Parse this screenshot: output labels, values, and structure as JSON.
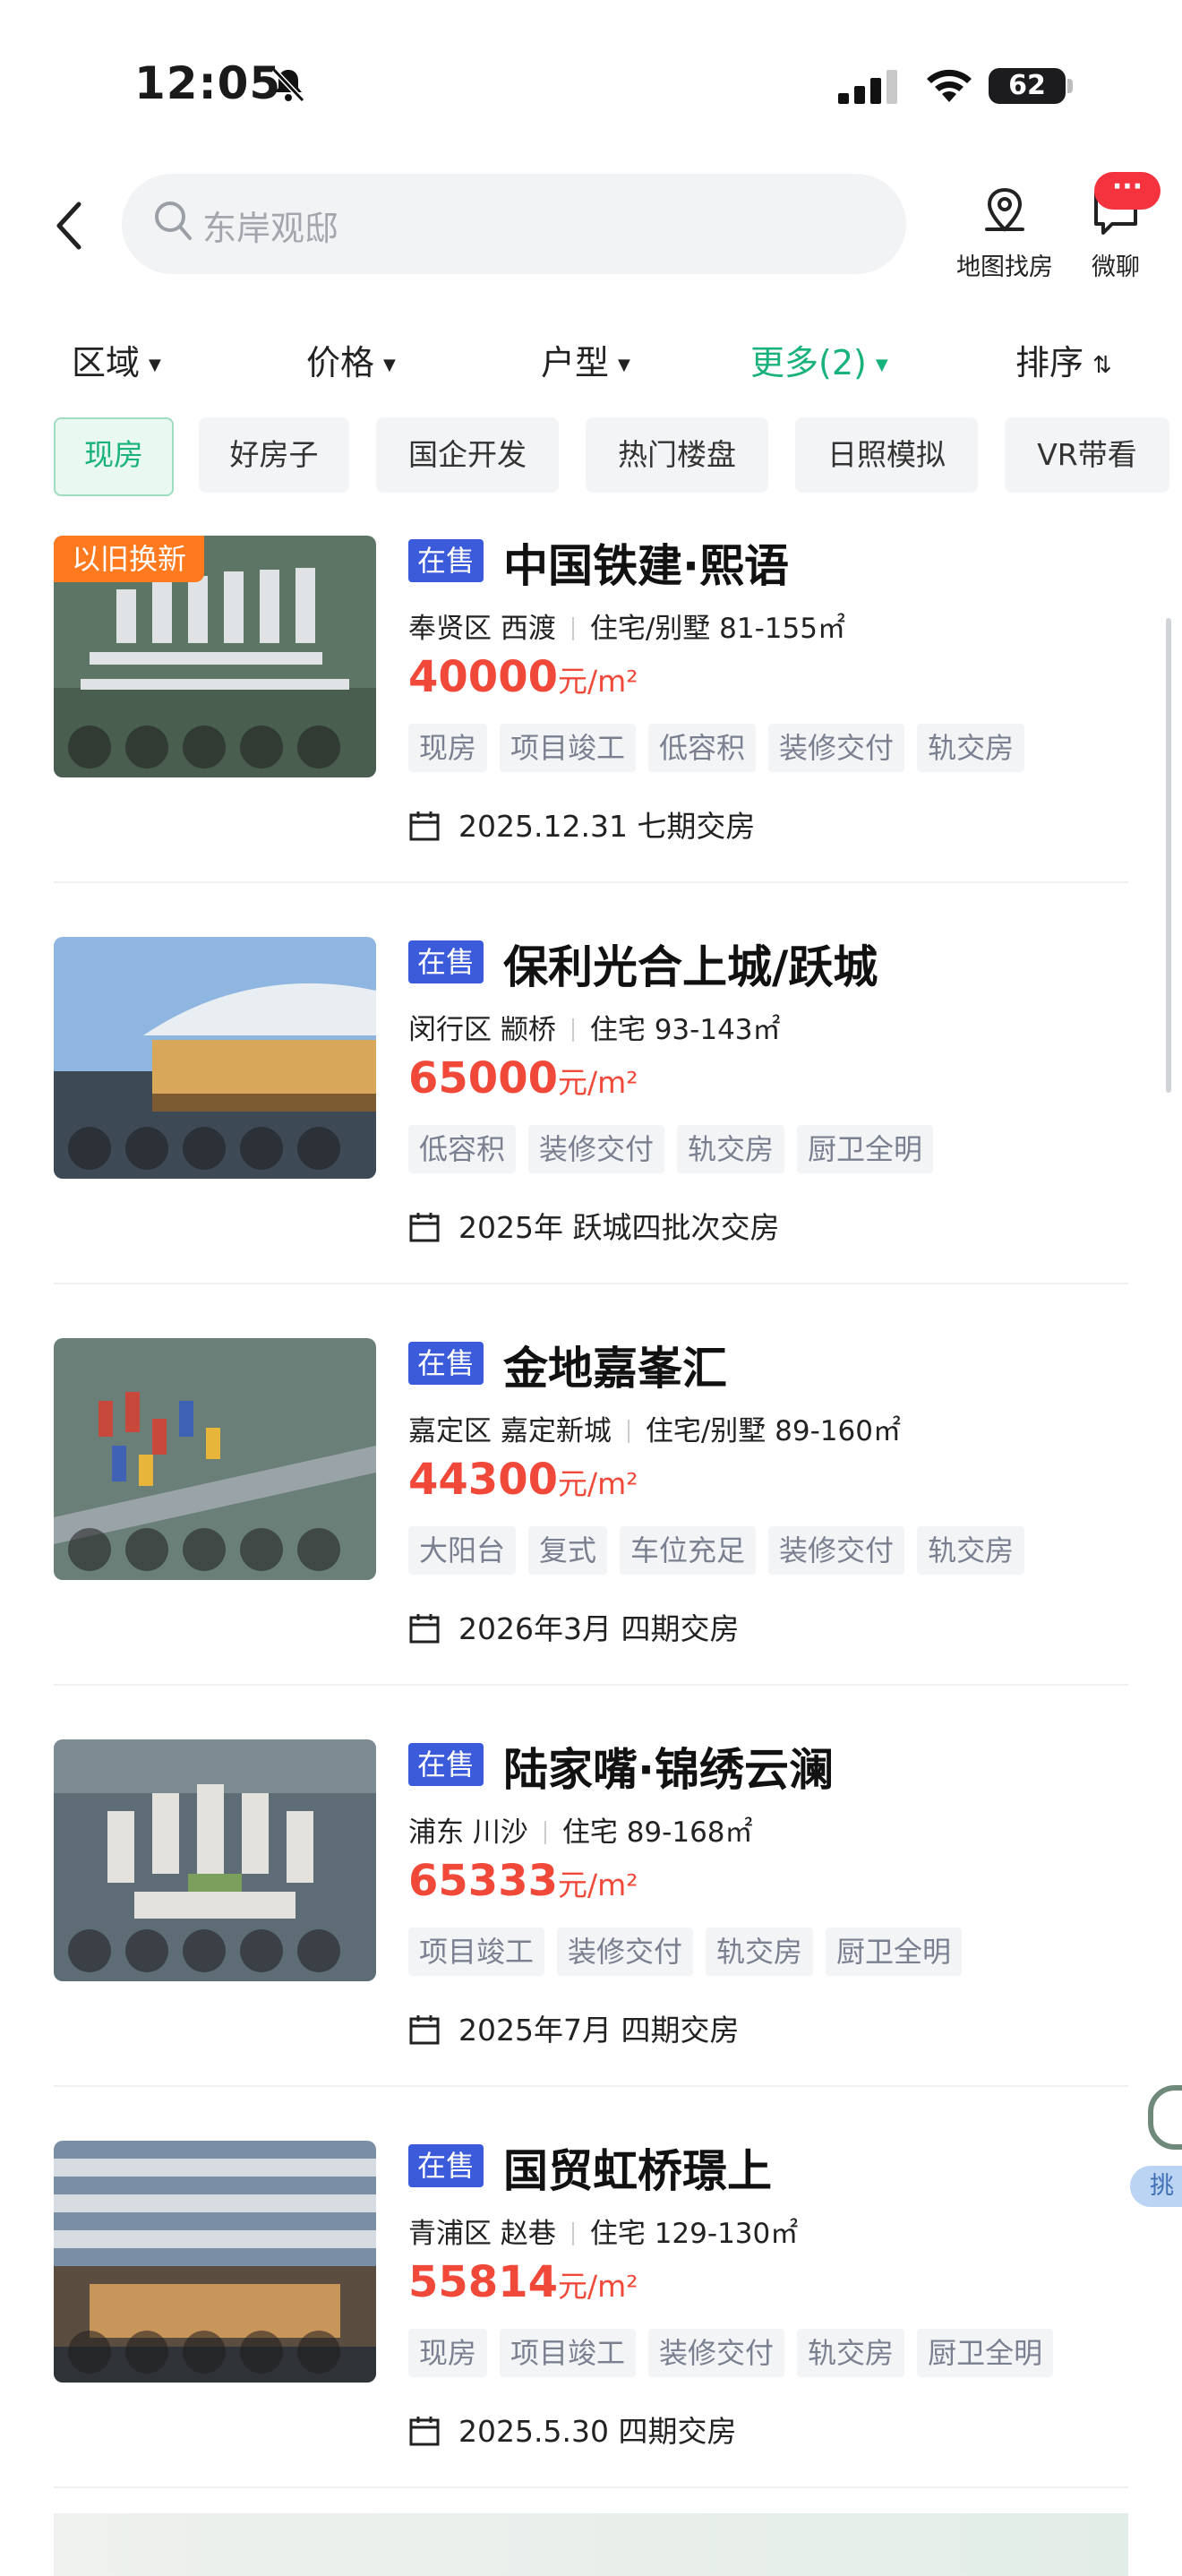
{
  "status_bar": {
    "time": "12:05",
    "battery": "62"
  },
  "search": {
    "placeholder": "东岸观邸"
  },
  "header_actions": {
    "map_label": "地图找房",
    "chat_label": "微聊",
    "chat_badge": "···"
  },
  "filters": [
    {
      "label": "区域"
    },
    {
      "label": "价格"
    },
    {
      "label": "户型"
    },
    {
      "label": "更多(2)",
      "active": true
    },
    {
      "label": "排序"
    }
  ],
  "chips": [
    "现房",
    "好房子",
    "国企开发",
    "热门楼盘",
    "日照模拟",
    "VR带看"
  ],
  "price_unit": "元/m²",
  "listings": [
    {
      "promo": "以旧换新",
      "status": "在售",
      "name": "中国铁建·熙语",
      "district": "奉贤区 西渡",
      "type": "住宅/别墅 81-155㎡",
      "price": "40000",
      "tags": [
        "现房",
        "项目竣工",
        "低容积",
        "装修交付",
        "轨交房"
      ],
      "delivery": "2025.12.31 七期交房"
    },
    {
      "status": "在售",
      "name": "保利光合上城/跃城",
      "district": "闵行区 颛桥",
      "type": "住宅 93-143㎡",
      "price": "65000",
      "tags": [
        "低容积",
        "装修交付",
        "轨交房",
        "厨卫全明"
      ],
      "delivery": "2025年 跃城四批次交房"
    },
    {
      "status": "在售",
      "name": "金地嘉峯汇",
      "district": "嘉定区 嘉定新城",
      "type": "住宅/别墅 89-160㎡",
      "price": "44300",
      "tags": [
        "大阳台",
        "复式",
        "车位充足",
        "装修交付",
        "轨交房"
      ],
      "delivery": "2026年3月 四期交房"
    },
    {
      "status": "在售",
      "name": "陆家嘴·锦绣云澜",
      "district": "浦东 川沙",
      "type": "住宅 89-168㎡",
      "price": "65333",
      "tags": [
        "项目竣工",
        "装修交付",
        "轨交房",
        "厨卫全明"
      ],
      "delivery": "2025年7月 四期交房"
    },
    {
      "status": "在售",
      "name": "国贸虹桥璟上",
      "district": "青浦区 赵巷",
      "type": "住宅 129-130㎡",
      "price": "55814",
      "tags": [
        "现房",
        "项目竣工",
        "装修交付",
        "轨交房",
        "厨卫全明"
      ],
      "delivery": "2025.5.30 四期交房"
    }
  ],
  "floating_tab": "挑",
  "colors": {
    "accent": "#18b27a",
    "price": "#f0493a",
    "status": "#3b5bdb",
    "promo": "#ff7a1f"
  }
}
